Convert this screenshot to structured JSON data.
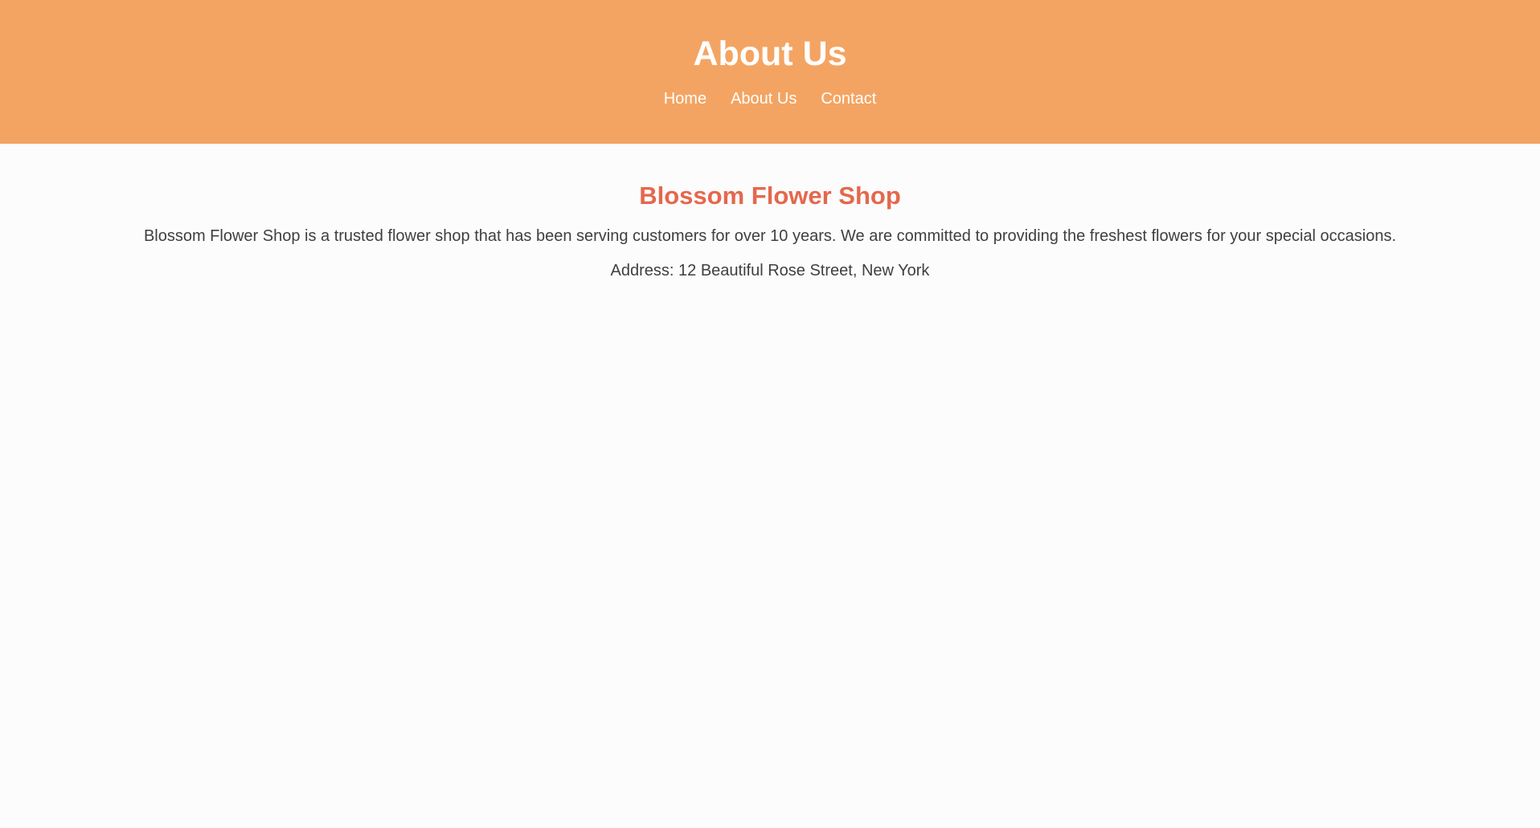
{
  "header": {
    "title": "About Us",
    "nav": [
      "Home",
      "About Us",
      "Contact"
    ]
  },
  "main": {
    "heading": "Blossom Flower Shop",
    "description": "Blossom Flower Shop is a trusted flower shop that has been serving customers for over 10 years. We are committed to providing the freshest flowers for your special occasions.",
    "address": "Address: 12 Beautiful Rose Street, New York"
  },
  "colors": {
    "header_bg": "#f4a462",
    "accent": "#e4684d",
    "text": "#3f3f3f",
    "page_bg": "#fcfcfc"
  }
}
